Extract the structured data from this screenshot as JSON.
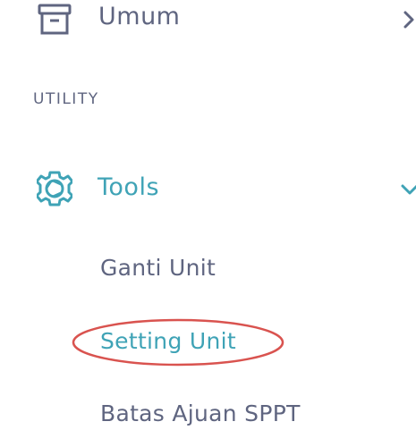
{
  "sidebar": {
    "items": [
      {
        "label": "Umum",
        "icon": "archive-icon",
        "chevron": "chevron-right-icon",
        "expanded": false
      }
    ],
    "section_header": "UTILITY",
    "tools": {
      "label": "Tools",
      "icon": "gear-icon",
      "chevron": "chevron-down-icon",
      "expanded": true,
      "submenu": [
        {
          "label": "Ganti Unit",
          "active": false
        },
        {
          "label": "Setting Unit",
          "active": true
        },
        {
          "label": "Batas Ajuan SPPT",
          "active": false
        }
      ]
    }
  },
  "colors": {
    "text_default": "#5f6580",
    "accent": "#3fa3b6",
    "annotation": "#d9534f",
    "background": "#ffffff"
  }
}
